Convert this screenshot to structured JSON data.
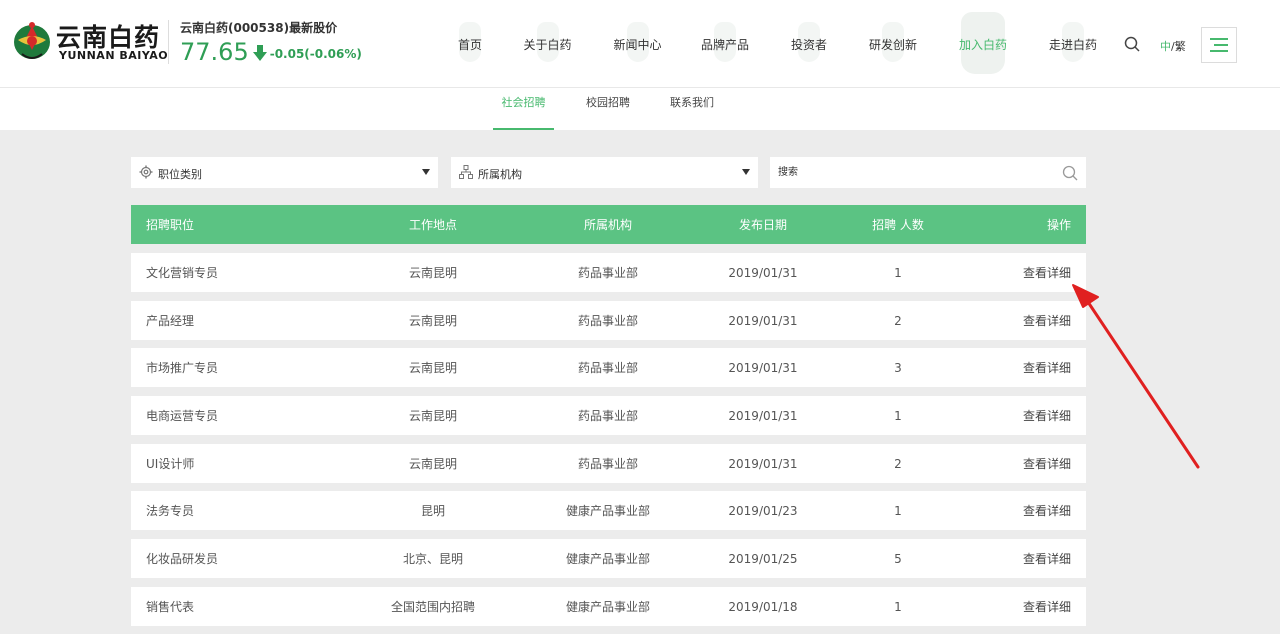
{
  "header": {
    "logo_cn": "云南白药",
    "logo_en": "YUNNAN BAIYAO",
    "stock_label": "云南白药(000538)最新股价",
    "stock_price": "77.65",
    "stock_change": "-0.05(-0.06%)",
    "nav": [
      "首页",
      "关于白药",
      "新闻中心",
      "品牌产品",
      "投资者",
      "研发创新",
      "加入白药",
      "走进白药"
    ],
    "active_nav": "加入白药",
    "lang_cn": "中",
    "lang_sep": "/",
    "lang_tw": "繁"
  },
  "subnav": {
    "items": [
      "社会招聘",
      "校园招聘",
      "联系我们"
    ],
    "active": "社会招聘"
  },
  "filters": {
    "category": "职位类别",
    "org": "所属机构",
    "search_placeholder": "搜索"
  },
  "table": {
    "headers": [
      "招聘职位",
      "工作地点",
      "所属机构",
      "发布日期",
      "招聘 人数",
      "操作"
    ],
    "rows": [
      {
        "title": "文化营销专员",
        "loc": "云南昆明",
        "org": "药品事业部",
        "date": "2019/01/31",
        "num": "1",
        "op": "查看详细"
      },
      {
        "title": "产品经理",
        "loc": "云南昆明",
        "org": "药品事业部",
        "date": "2019/01/31",
        "num": "2",
        "op": "查看详细"
      },
      {
        "title": "市场推广专员",
        "loc": "云南昆明",
        "org": "药品事业部",
        "date": "2019/01/31",
        "num": "3",
        "op": "查看详细"
      },
      {
        "title": "电商运营专员",
        "loc": "云南昆明",
        "org": "药品事业部",
        "date": "2019/01/31",
        "num": "1",
        "op": "查看详细"
      },
      {
        "title": "UI设计师",
        "loc": "云南昆明",
        "org": "药品事业部",
        "date": "2019/01/31",
        "num": "2",
        "op": "查看详细"
      },
      {
        "title": "法务专员",
        "loc": "昆明",
        "org": "健康产品事业部",
        "date": "2019/01/23",
        "num": "1",
        "op": "查看详细"
      },
      {
        "title": "化妆品研发员",
        "loc": "北京、昆明",
        "org": "健康产品事业部",
        "date": "2019/01/25",
        "num": "5",
        "op": "查看详细"
      },
      {
        "title": "销售代表",
        "loc": "全国范围内招聘",
        "org": "健康产品事业部",
        "date": "2019/01/18",
        "num": "1",
        "op": "查看详细"
      }
    ]
  },
  "colors": {
    "brand_green": "#5bc383",
    "stock_green": "#2f9e55",
    "annotation_red": "#e02020"
  }
}
